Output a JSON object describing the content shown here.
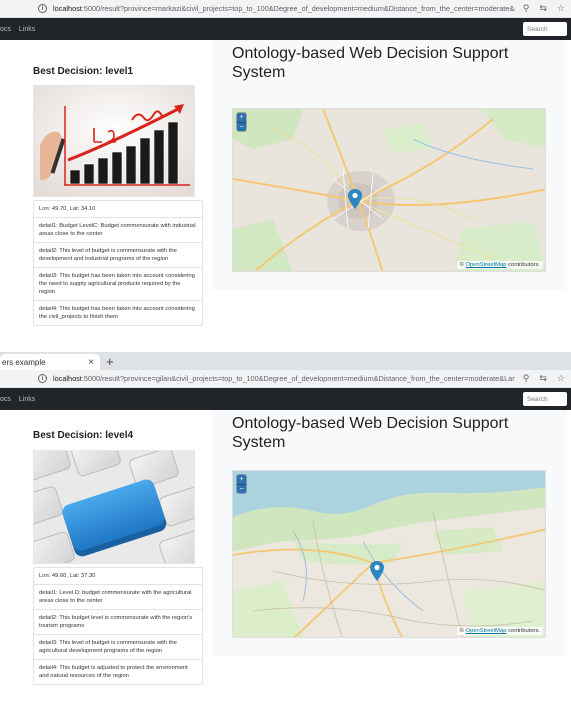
{
  "screens": [
    {
      "url": {
        "host": "localhost",
        "rest": ":5000/result?province=markazi&civil_projects=top_to_100&Degree_of_development=medium&Distance_from_the_center=moderate&L..."
      },
      "nav": {
        "left": "ocs",
        "links": "Links",
        "search_placeholder": "Search"
      },
      "best_decision": "Best Decision: level1",
      "lonlat": "Lon: 49.70, Lat: 34.10",
      "details": [
        "detail1: Budget LevelC: Budget commensurate with industrial areas close to the center",
        "detail2: This level of budget is commensurate with the development and industrial programs of the region",
        "detail3: This budget has been taken into account considering the need to supply agricultural products required by the region",
        "detail4: This budget has been taken into account considering the civil_projects to finish them"
      ],
      "title": "Ontology-based Web Decision Support System",
      "map": {
        "zoom_in": "+",
        "zoom_out": "−",
        "attribution_prefix": "©",
        "attribution_link": "OpenStreetMap",
        "attribution_suffix": "contributors."
      }
    },
    {
      "tab": {
        "title": "ers example",
        "close": "×",
        "new": "+"
      },
      "url": {
        "host": "localhost",
        "rest": ":5000/result?province=gilan&civil_projects=top_to_100&Degree_of_development=medium&Distance_from_the_center=moderate&Lan..."
      },
      "nav": {
        "left": "ocs",
        "links": "Links",
        "search_placeholder": "Search"
      },
      "best_decision": "Best Decision: level4",
      "lonlat": "Lon: 49.60, Lat: 37.30",
      "details": [
        "detail1: Level D: budget commensurate with the agricultural areas close to the center",
        "detail2: This budget level is commensurate with the region's tourism programs",
        "detail3: This level of budget is commensurate with the agricultural development programs of the region",
        "detail4: This budget is adjusted to protect the environment and natural resources of the region"
      ],
      "title": "Ontology-based Web Decision Support System",
      "map": {
        "zoom_in": "+",
        "zoom_out": "−",
        "attribution_prefix": "©",
        "attribution_link": "OpenStreetMap",
        "attribution_suffix": "contributors."
      }
    }
  ],
  "colors": {
    "navbar": "#212529",
    "panel": "#f8f9fa",
    "zoom": "#2f6fb3",
    "marker": "#2e86c1",
    "chart_arrow": "#d9241c",
    "key": "#2f8fd8"
  },
  "icons": [
    "info-icon",
    "search-zoom-icon",
    "translate-icon",
    "star-icon",
    "map-marker-icon"
  ]
}
